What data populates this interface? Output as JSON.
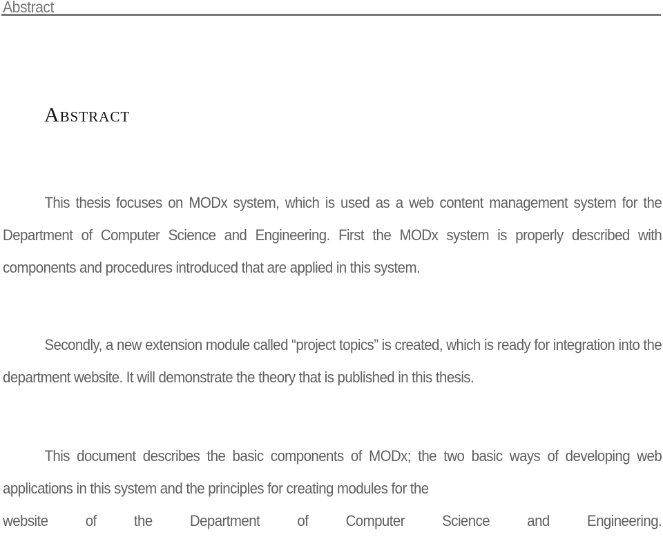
{
  "header": {
    "running_title": "Abstract"
  },
  "page": {
    "title": "Abstract",
    "paragraphs": [
      "This thesis focuses on MODx system, which is used as a web content management system for the Department of Computer Science and Engineering. First the MODx system is properly described with components and procedures introduced that are applied in this system.",
      "Secondly, a new extension module called “project topics” is created, which is ready for integration into the department website. It will demonstrate the theory that is published in this thesis.",
      "This document describes the basic components of MODx; the two basic ways of developing web applications in this system and the principles for creating modules for the",
      "website of the Department of Computer Science and Engineering."
    ]
  }
}
